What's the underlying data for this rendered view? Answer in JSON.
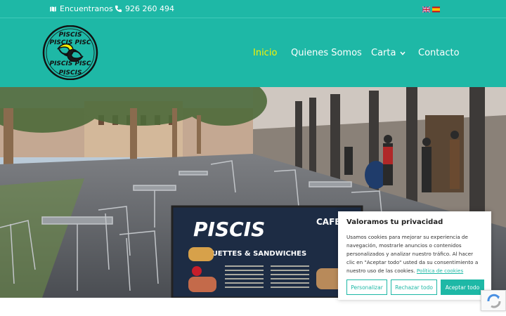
{
  "topbar": {
    "location_label": "Encuentranos",
    "phone_label": "926 260 494",
    "languages": [
      "English",
      "Español"
    ]
  },
  "logo": {
    "brand_name": "PISCIS"
  },
  "nav": {
    "items": [
      {
        "label": "Inicio",
        "active": true
      },
      {
        "label": "Quienes Somos",
        "active": false
      },
      {
        "label": "Carta",
        "active": false,
        "has_dropdown": true
      },
      {
        "label": "Contacto",
        "active": false
      }
    ]
  },
  "hero": {
    "sign_title": "PISCIS",
    "sign_subtitle": "BAGUETTES & SANDWICHES",
    "sign_side": "CAFE BAR"
  },
  "cookie": {
    "title": "Valoramos tu privacidad",
    "body": "Usamos cookies para mejorar su experiencia de navegación, mostrarle anuncios o contenidos personalizados y analizar nuestro tráfico. Al hacer clic en \"Aceptar todo\" usted da su consentimiento a nuestro uso de las cookies.",
    "policy_link": "Política de cookies",
    "customize_label": "Personalizar",
    "reject_label": "Rechazar todo",
    "accept_label": "Aceptar todo"
  },
  "colors": {
    "brand_teal": "#1eb8a6",
    "active_nav": "#f7f200"
  }
}
